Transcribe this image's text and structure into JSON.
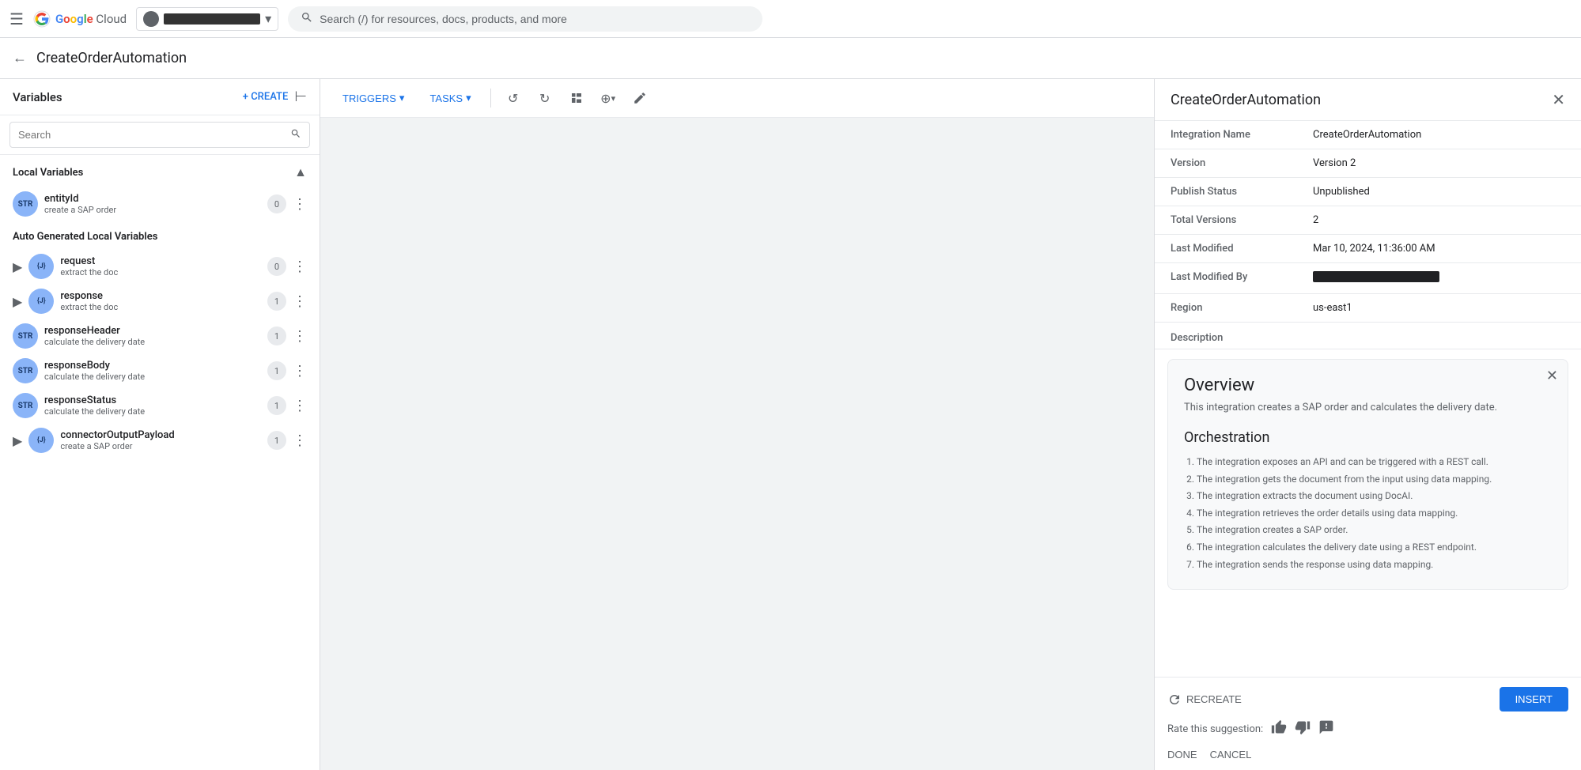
{
  "topNav": {
    "hamburger": "☰",
    "logo": {
      "g": "G",
      "o1": "o",
      "o2": "o",
      "g2": "g",
      "l": "l",
      "e": "e",
      "cloud": " Cloud"
    },
    "projectName": "████████████████",
    "searchPlaceholder": "Search (/) for resources, docs, products, and more"
  },
  "pageHeader": {
    "backArrow": "←",
    "title": "CreateOrderAutomation"
  },
  "sidebar": {
    "title": "Variables",
    "createLabel": "+ CREATE",
    "collapseIcon": "⊢",
    "searchPlaceholder": "Search",
    "sections": {
      "local": {
        "title": "Local Variables",
        "items": [
          {
            "badge": "STR",
            "name": "entityId",
            "desc": "create a SAP order",
            "count": "0",
            "type": "str"
          }
        ]
      },
      "autoGenerated": {
        "title": "Auto Generated Local Variables",
        "items": [
          {
            "badge": "{J}",
            "name": "request",
            "desc": "extract the doc",
            "count": "0",
            "type": "json",
            "expandable": true
          },
          {
            "badge": "{J}",
            "name": "response",
            "desc": "extract the doc",
            "count": "1",
            "type": "json",
            "expandable": true
          },
          {
            "badge": "STR",
            "name": "responseHeader",
            "desc": "calculate the delivery date",
            "count": "1",
            "type": "str"
          },
          {
            "badge": "STR",
            "name": "responseBody",
            "desc": "calculate the delivery date",
            "count": "1",
            "type": "str"
          },
          {
            "badge": "STR",
            "name": "responseStatus",
            "desc": "calculate the delivery date",
            "count": "1",
            "type": "str"
          },
          {
            "badge": "{J}",
            "name": "connectorOutputPayload",
            "desc": "create a SAP order",
            "count": "1",
            "type": "json",
            "expandable": true
          }
        ]
      }
    }
  },
  "canvasToolbar": {
    "triggersLabel": "TRIGGERS",
    "tasksLabel": "TASKS",
    "undoIcon": "↺",
    "redoIcon": "↻",
    "layoutIcon": "⊞",
    "zoomIcon": "⊕",
    "editIcon": "✏"
  },
  "rightPanel": {
    "title": "CreateOrderAutomation",
    "closeIcon": "✕",
    "fields": {
      "integrationName": {
        "label": "Integration Name",
        "value": "CreateOrderAutomation"
      },
      "version": {
        "label": "Version",
        "value": "Version 2"
      },
      "publishStatus": {
        "label": "Publish Status",
        "value": "Unpublished"
      },
      "totalVersions": {
        "label": "Total Versions",
        "value": "2"
      },
      "lastModified": {
        "label": "Last Modified",
        "value": "Mar 10, 2024, 11:36:00 AM"
      },
      "lastModifiedBy": {
        "label": "Last Modified By",
        "value": "████████████████████"
      },
      "region": {
        "label": "Region",
        "value": "us-east1"
      }
    },
    "descriptionLabel": "Description",
    "overview": {
      "closeIcon": "✕",
      "title": "Overview",
      "text": "This integration creates a SAP order and calculates the delivery date.",
      "orchestrationTitle": "Orchestration",
      "steps": [
        "The integration exposes an API and can be triggered with a REST call.",
        "The integration gets the document from the input using data mapping.",
        "The integration extracts the document using DocAI.",
        "The integration retrieves the order details using data mapping.",
        "The integration creates a SAP order.",
        "The integration calculates the delivery date using a REST endpoint.",
        "The integration sends the response using data mapping."
      ]
    },
    "footer": {
      "recreateLabel": "RECREATE",
      "insertLabel": "INSERT",
      "ratingLabel": "Rate this suggestion:",
      "thumbUpIcon": "👍",
      "thumbDownIcon": "👎",
      "commentIcon": "💬",
      "doneLabel": "DONE",
      "cancelLabel": "CANCEL"
    }
  }
}
